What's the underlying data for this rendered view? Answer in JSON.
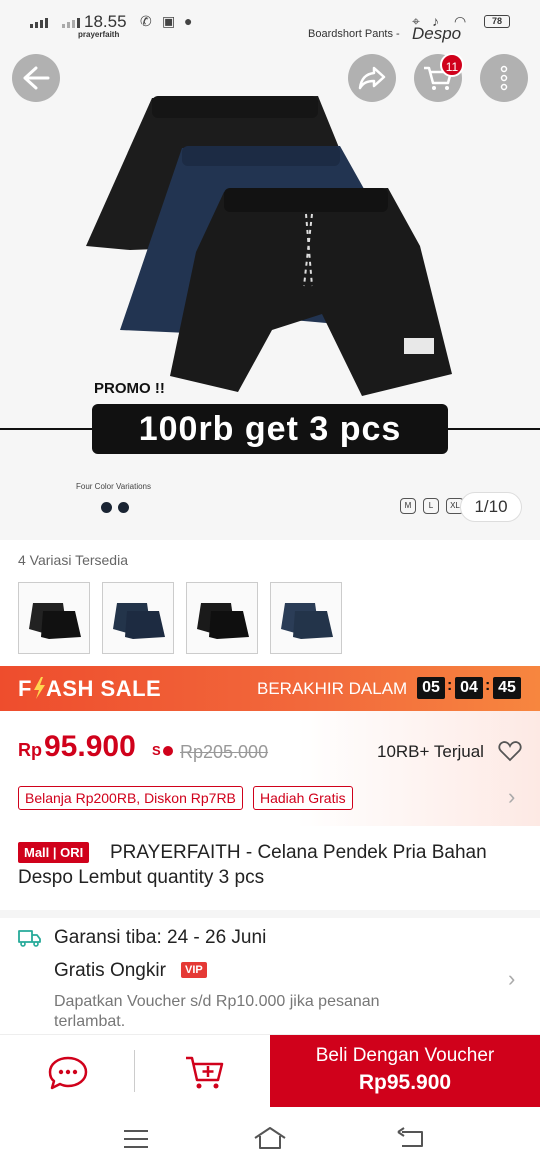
{
  "status_bar": {
    "time": "18.55",
    "brand": "prayerfaith",
    "battery": "78",
    "product_label": "Boardshort Pants -",
    "product_brand": "Despo"
  },
  "top_actions": {
    "cart_count": "11"
  },
  "hero": {
    "promo_small": "PROMO !!",
    "promo_big": "100rb get 3 pcs",
    "variations_caption": "Four Color Variations",
    "sizes": [
      "M",
      "L",
      "XL"
    ],
    "pager": "1/10"
  },
  "variations": {
    "label": "4 Variasi Tersedia",
    "items": [
      {
        "color": "#1b1b1b",
        "alt": "#23344a"
      },
      {
        "color": "#1f2f47",
        "alt": "#181818"
      },
      {
        "color": "#151515",
        "alt": "#222"
      },
      {
        "color": "#23344a",
        "alt": "#2b3d57"
      }
    ]
  },
  "flash_sale": {
    "title_left": "F",
    "title_right": "ASH SALE",
    "ends_label": "BERAKHIR DALAM",
    "hours": "05",
    "minutes": "04",
    "seconds": "45"
  },
  "pricing": {
    "currency": "Rp",
    "price": "95.900",
    "old_price": "Rp205.000",
    "sold": "10RB+ Terjual",
    "tags": [
      "Belanja Rp200RB, Diskon Rp7RB",
      "Hadiah Gratis"
    ]
  },
  "product": {
    "mall_tag": "Mall | ORI",
    "title": "PRAYERFAITH - Celana Pendek Pria Bahan Despo Lembut quantity 3 pcs"
  },
  "shipping": {
    "guarantee": "Garansi tiba: 24 - 26 Juni",
    "free_shipping": "Gratis Ongkir",
    "vip": "VIP",
    "voucher_note": "Dapatkan Voucher s/d Rp10.000 jika pesanan terlambat."
  },
  "bottom_bar": {
    "buy_line1": "Beli Dengan Voucher",
    "buy_line2": "Rp95.900"
  },
  "colors": {
    "accent": "#d0011b",
    "flash": "#ee4d2d"
  }
}
